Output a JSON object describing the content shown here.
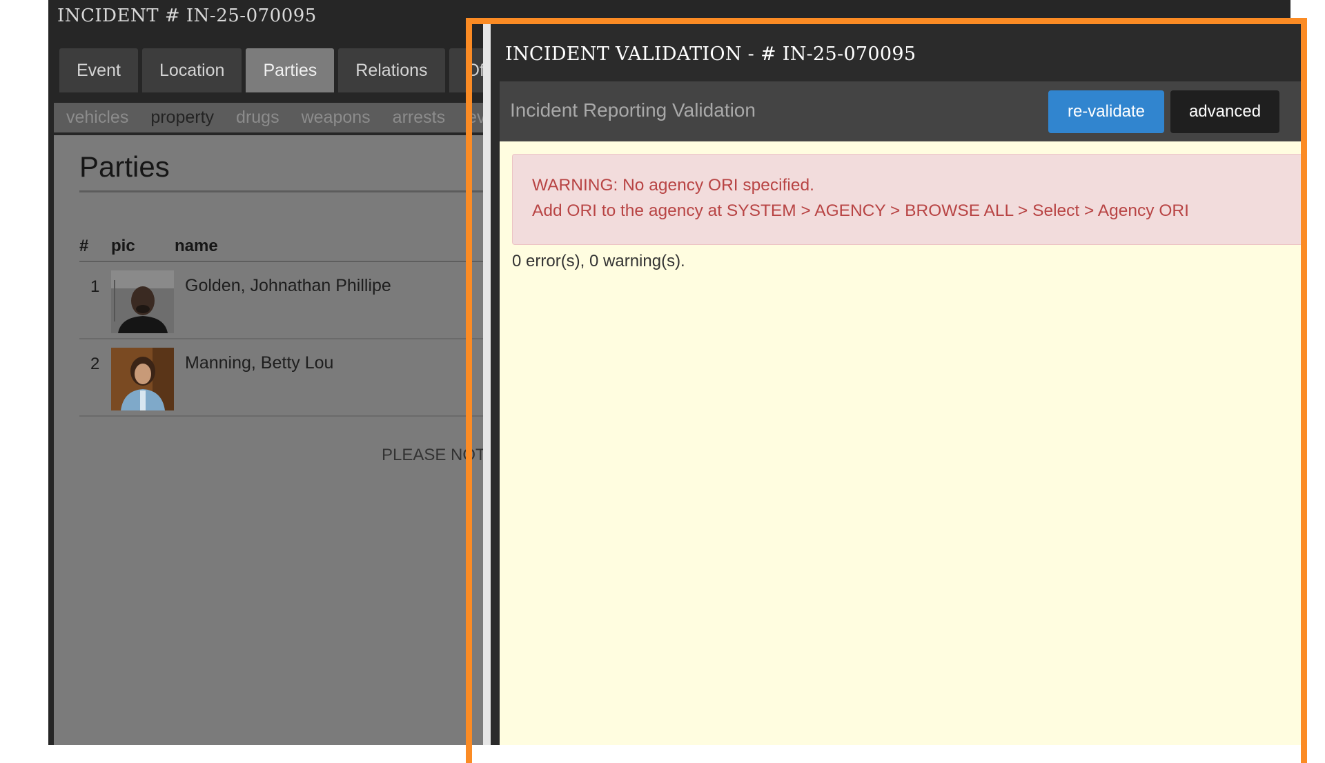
{
  "incident_window": {
    "title": "INCIDENT # IN-25-070095",
    "tabs": [
      {
        "label": "Event"
      },
      {
        "label": "Location"
      },
      {
        "label": "Parties"
      },
      {
        "label": "Relations"
      },
      {
        "label": "Of"
      }
    ],
    "subtabs": [
      {
        "label": "vehicles"
      },
      {
        "label": "property"
      },
      {
        "label": "drugs"
      },
      {
        "label": "weapons"
      },
      {
        "label": "arrests"
      },
      {
        "label": "ev"
      }
    ],
    "active_tab": "Parties",
    "active_subtab": "property",
    "parties": {
      "heading": "Parties",
      "columns": [
        "#",
        "pic",
        "name"
      ],
      "rows": [
        {
          "num": "1",
          "name": "Golden, Johnathan Phillipe"
        },
        {
          "num": "2",
          "name": "Manning, Betty Lou"
        }
      ],
      "note": "PLEASE NOTE"
    }
  },
  "validation_modal": {
    "title": "INCIDENT VALIDATION - # IN-25-070095",
    "toolbar_title": "Incident Reporting Validation",
    "revalidate_label": "re-validate",
    "advanced_label": "advanced",
    "warning_line1": "WARNING: No agency ORI specified.",
    "warning_line2": "Add ORI to the agency at SYSTEM > AGENCY > BROWSE ALL > Select > Agency ORI",
    "summary": "0 error(s), 0 warning(s)."
  },
  "colors": {
    "highlight": "#fb8b24",
    "primary_button": "#3185cf",
    "warning_text": "#b84444",
    "warning_bg": "#f2dcdc",
    "modal_body_bg": "#fffde0"
  }
}
